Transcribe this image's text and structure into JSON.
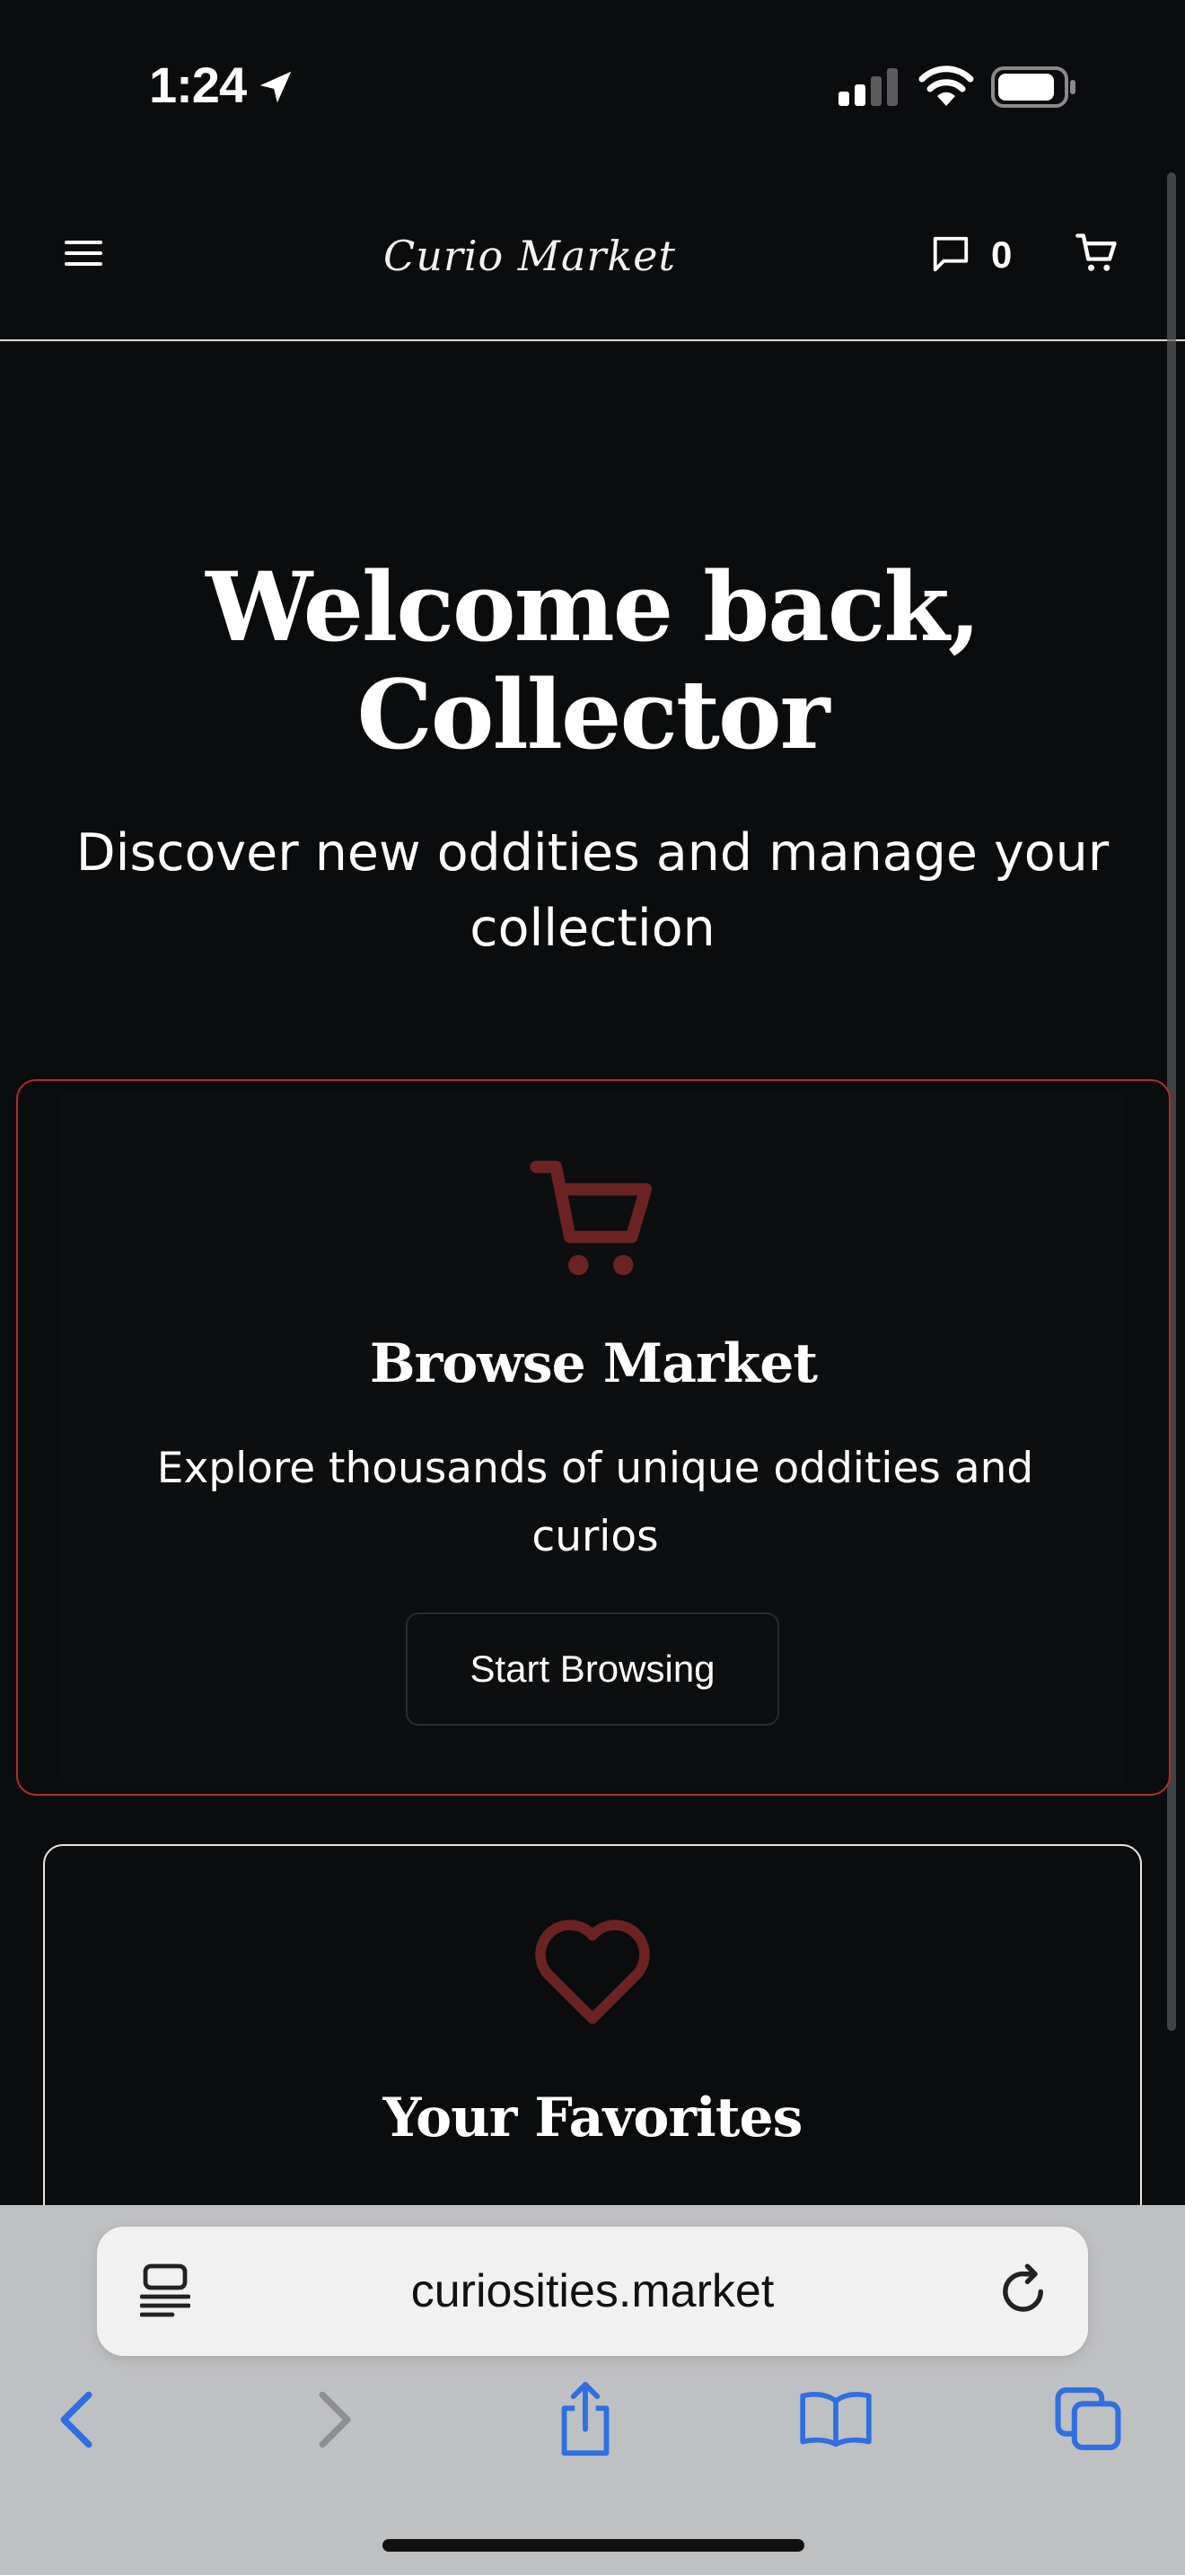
{
  "status_bar": {
    "time": "1:24"
  },
  "header": {
    "brand": "Curio Market",
    "message_count": "0"
  },
  "hero": {
    "title_line1": "Welcome back,",
    "title_line2": "Collector",
    "subtitle_line1": "Discover new oddities and manage your",
    "subtitle_line2": "collection"
  },
  "cards": {
    "browse": {
      "title": "Browse Market",
      "desc_line1": "Explore thousands of unique oddities and",
      "desc_line2": "curios",
      "button": "Start Browsing"
    },
    "favorites": {
      "title": "Your Favorites"
    }
  },
  "browser": {
    "url": "curiosities.market"
  },
  "colors": {
    "background": "#0b0c0d",
    "accent_red": "#b32b2b",
    "icon_red": "#6a2222",
    "browser_blue": "#2f6fe0"
  }
}
